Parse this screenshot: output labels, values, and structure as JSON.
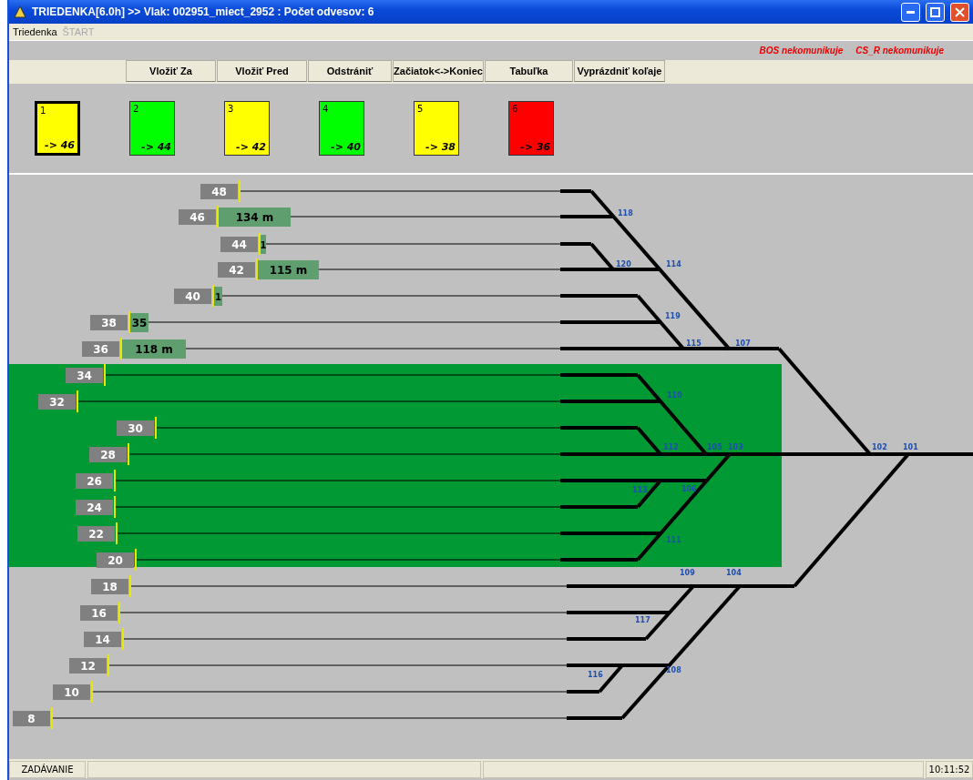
{
  "window": {
    "title": "TRIEDENKA[6.0h] >> Vlak: 002951_miect_2952 : Počet odvesov: 6"
  },
  "menu": [
    {
      "label": "Triedenka",
      "disabled": false
    },
    {
      "label": "ŠTART",
      "disabled": true
    }
  ],
  "alerts": [
    "BOS nekomunikuje",
    "CS_R nekomunikuje"
  ],
  "toolbar": [
    "Vložiť Za",
    "Vložiť Pred",
    "Odstrániť",
    "Začiatok<->Koniec",
    "Tabuľka",
    "Vyprázdniť koľaje"
  ],
  "cars": [
    {
      "number": "1",
      "destination": "-> 46",
      "color": "#ffff00",
      "selected": true
    },
    {
      "number": "2",
      "destination": "-> 44",
      "color": "#00ff00",
      "selected": false
    },
    {
      "number": "3",
      "destination": "-> 42",
      "color": "#ffff00",
      "selected": false
    },
    {
      "number": "4",
      "destination": "-> 40",
      "color": "#00ff00",
      "selected": false
    },
    {
      "number": "5",
      "destination": "-> 38",
      "color": "#ffff00",
      "selected": false
    },
    {
      "number": "6",
      "destination": "-> 36",
      "color": "#ff0000",
      "selected": false
    }
  ],
  "tracks": [
    {
      "number": "48",
      "selected": false
    },
    {
      "number": "46",
      "occupancy": "134 m",
      "selected": false
    },
    {
      "number": "44",
      "occupancy": "1",
      "selected": false
    },
    {
      "number": "42",
      "occupancy": "115 m",
      "selected": false
    },
    {
      "number": "40",
      "occupancy": "1",
      "selected": false
    },
    {
      "number": "38",
      "occupancy": "35",
      "selected": false
    },
    {
      "number": "36",
      "occupancy": "118 m",
      "selected": false
    },
    {
      "number": "34",
      "selected": true
    },
    {
      "number": "32",
      "selected": true
    },
    {
      "number": "30",
      "selected": true
    },
    {
      "number": "28",
      "selected": true
    },
    {
      "number": "26",
      "selected": true
    },
    {
      "number": "24",
      "selected": true
    },
    {
      "number": "22",
      "selected": true
    },
    {
      "number": "20",
      "selected": true
    },
    {
      "number": "18",
      "selected": false
    },
    {
      "number": "16",
      "selected": false
    },
    {
      "number": "14",
      "selected": false
    },
    {
      "number": "12",
      "selected": false
    },
    {
      "number": "10",
      "selected": false
    },
    {
      "number": "8",
      "selected": false
    }
  ],
  "switches": [
    "118",
    "120",
    "114",
    "119",
    "115",
    "107",
    "110",
    "112",
    "105",
    "103",
    "102",
    "101",
    "113",
    "106",
    "111",
    "109",
    "104",
    "117",
    "116",
    "108"
  ],
  "status_bar": {
    "mode": "ZADÁVANIE",
    "time": "10:11:52"
  }
}
